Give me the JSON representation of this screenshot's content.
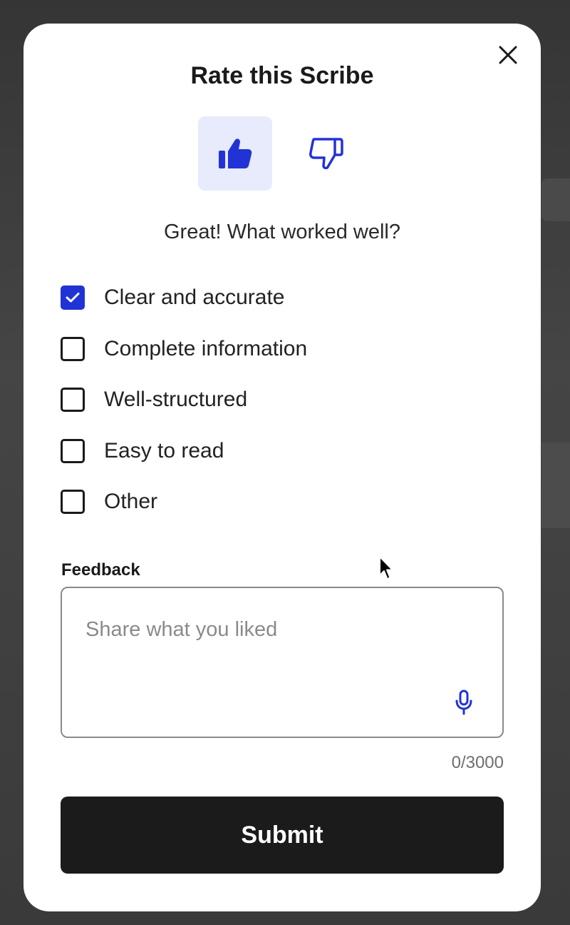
{
  "dialog": {
    "title": "Rate this Scribe",
    "close_icon": "close-icon",
    "rating": {
      "selected": "thumbs-up",
      "options": [
        {
          "name": "thumbs-up",
          "icon": "thumbs-up-icon",
          "selected": true
        },
        {
          "name": "thumbs-down",
          "icon": "thumbs-down-icon",
          "selected": false
        }
      ]
    },
    "prompt": "Great! What worked well?",
    "options": [
      {
        "label": "Clear and accurate",
        "checked": true
      },
      {
        "label": "Complete information",
        "checked": false
      },
      {
        "label": "Well-structured",
        "checked": false
      },
      {
        "label": "Easy to read",
        "checked": false
      },
      {
        "label": "Other",
        "checked": false
      }
    ],
    "feedback": {
      "label": "Feedback",
      "value": "",
      "placeholder": "Share what you liked",
      "mic_icon": "microphone-icon",
      "counter": "0/3000"
    },
    "submit_label": "Submit"
  },
  "colors": {
    "accent": "#2233d6",
    "selected_bg": "#e7ebfb",
    "submit_bg": "#1b1b1b",
    "overlay": "#3f3f3f"
  }
}
